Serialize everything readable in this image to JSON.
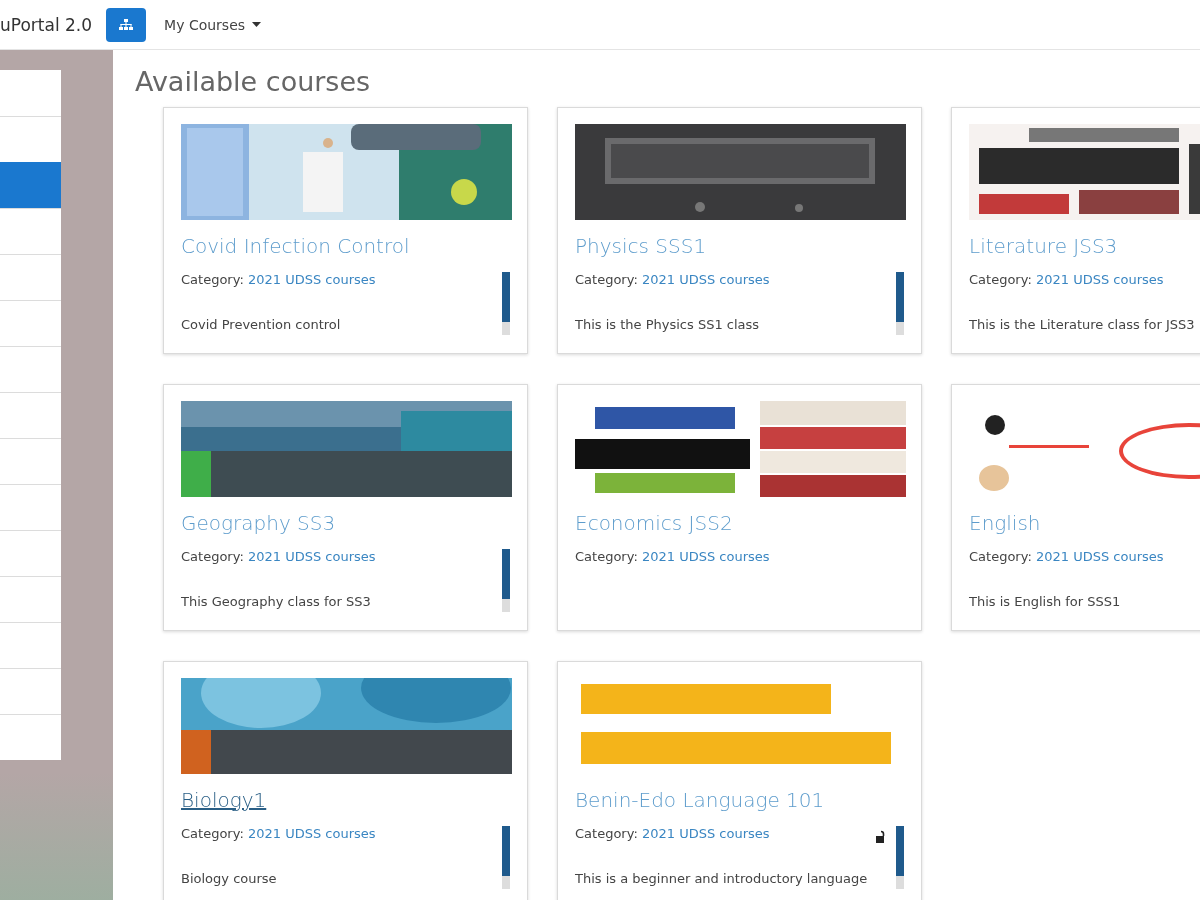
{
  "navbar": {
    "brand": "uPortal 2.0",
    "menu": {
      "label": "My Courses"
    }
  },
  "sidebar": {
    "items": [
      {
        "selected": false
      },
      {
        "selected": true
      },
      {
        "selected": false
      },
      {
        "selected": false
      },
      {
        "selected": false
      },
      {
        "selected": false
      },
      {
        "selected": false
      },
      {
        "selected": false
      },
      {
        "selected": false
      },
      {
        "selected": false
      },
      {
        "selected": false
      },
      {
        "selected": false
      },
      {
        "selected": false
      },
      {
        "selected": false
      }
    ]
  },
  "heading": "Available courses",
  "courses": [
    {
      "title": "Covid Infection Control",
      "category_label": "Category:",
      "category": "2021 UDSS courses",
      "description": "Covid Prevention control",
      "level": 0.8,
      "hovered": false,
      "unlocked": false
    },
    {
      "title": "Physics SSS1",
      "category_label": "Category:",
      "category": "2021 UDSS courses",
      "description": "This is the Physics SS1 class",
      "level": 0.8,
      "hovered": false,
      "unlocked": false
    },
    {
      "title": "Literature JSS3",
      "category_label": "Category:",
      "category": "2021 UDSS courses",
      "description": "This is the Literature class for JSS3",
      "hovered": false
    },
    {
      "title": "Geography SS3",
      "category_label": "Category:",
      "category": "2021 UDSS courses",
      "description": "This Geography class for SS3",
      "level": 0.8,
      "hovered": false,
      "unlocked": false
    },
    {
      "title": "Economics JSS2",
      "category_label": "Category:",
      "category": "2021 UDSS courses",
      "hovered": false,
      "unlocked": false
    },
    {
      "title": "English",
      "category_label": "Category:",
      "category": "2021 UDSS courses",
      "description": "This is English for SSS1",
      "hovered": false
    },
    {
      "title": "Biology1",
      "category_label": "Category:",
      "category": "2021 UDSS courses",
      "description": "Biology course",
      "level": 0.8,
      "hovered": true,
      "unlocked": false
    },
    {
      "title": "Benin-Edo Language 101",
      "category_label": "Category:",
      "category": "2021 UDSS courses",
      "description": "This is a beginner and introductory language",
      "level": 0.8,
      "hovered": false,
      "unlocked": true
    }
  ]
}
